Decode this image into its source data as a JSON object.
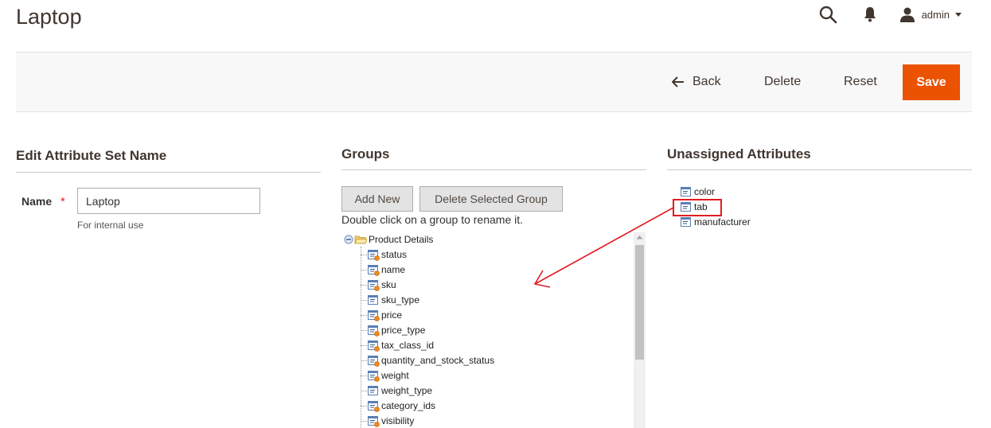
{
  "page": {
    "title": "Laptop"
  },
  "header": {
    "user": "admin"
  },
  "actions": {
    "back": "Back",
    "delete": "Delete",
    "reset": "Reset",
    "save": "Save"
  },
  "edit_name": {
    "title": "Edit Attribute Set Name",
    "label": "Name",
    "required_mark": "*",
    "value": "Laptop",
    "hint": "For internal use"
  },
  "groups": {
    "title": "Groups",
    "add_new": "Add New",
    "delete_selected": "Delete Selected Group",
    "hint": "Double click on a group to rename it.",
    "tree": {
      "group_name": "Product Details",
      "attributes": [
        {
          "name": "status",
          "system": true
        },
        {
          "name": "name",
          "system": true
        },
        {
          "name": "sku",
          "system": true
        },
        {
          "name": "sku_type",
          "system": false
        },
        {
          "name": "price",
          "system": true
        },
        {
          "name": "price_type",
          "system": true
        },
        {
          "name": "tax_class_id",
          "system": true
        },
        {
          "name": "quantity_and_stock_status",
          "system": true
        },
        {
          "name": "weight",
          "system": true
        },
        {
          "name": "weight_type",
          "system": false
        },
        {
          "name": "category_ids",
          "system": true
        },
        {
          "name": "visibility",
          "system": true
        }
      ]
    }
  },
  "unassigned": {
    "title": "Unassigned Attributes",
    "attributes": [
      "color",
      "tab",
      "manufacturer"
    ],
    "highlighted": "tab"
  },
  "colors": {
    "accent": "#eb5202",
    "annotation": "#e11b22",
    "title": "#41362f"
  }
}
